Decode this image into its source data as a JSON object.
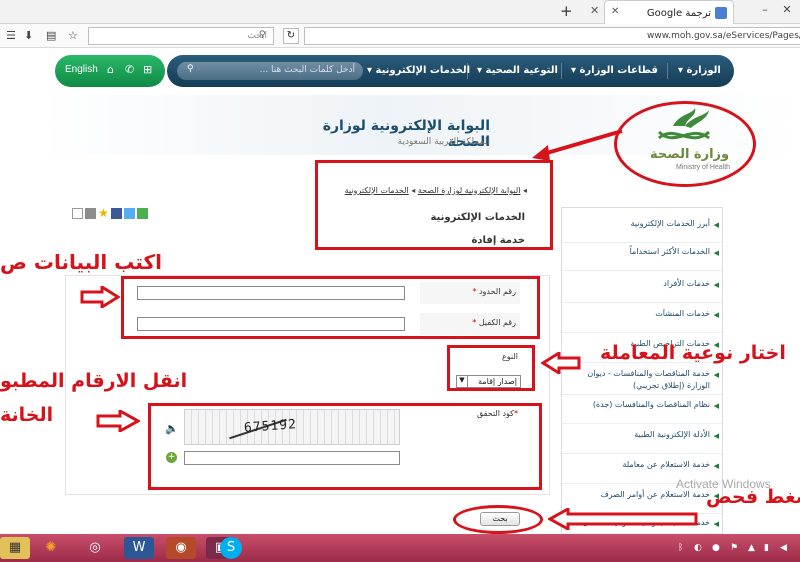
{
  "browser": {
    "tab_title": "ترجمة Google",
    "search_placeholder": "ابحث",
    "url": "www.moh.gov.sa/eServices/Pages/Efad",
    "controls": {
      "minimize": "–",
      "close": "✕",
      "new_tab": "+",
      "tab_close": "✕"
    }
  },
  "header": {
    "lang_label": "English",
    "search_placeholder": "أدخل كلمات البحث هنا ...",
    "nav": [
      "الوزارة",
      "قطاعات الوزارة",
      "التوعية الصحية",
      "الخدمات الإلكترونية"
    ],
    "portal_title": "البوابة الإلكترونية لوزارة الصحة",
    "portal_subtitle": "المملكة العربية السعودية",
    "logo_ar": "وزارة الصحة",
    "logo_en": "Ministry of Health",
    "logo_color": "#6b8a3a"
  },
  "breadcrumb": {
    "item1": "البوابة الإلكترونية لوزارة الصحة",
    "item2": "الخدمات الإلكترونية"
  },
  "page": {
    "section_title": "الخدمات الإلكترونية",
    "service_title": "خدمة إفادة"
  },
  "form": {
    "border_no_label": "رقم الحدود",
    "sponsor_no_label": "رقم الكفيل",
    "type_label": "النوع",
    "type_value": "إصدار إقامة",
    "captcha_label": "كود التحقق",
    "captcha_code": "675192",
    "submit_label": "بحث",
    "required_mark": "*"
  },
  "sidebar": {
    "items": [
      "أبرز الخدمات الإلكترونية",
      "الخدمات الأكثر استخداماً",
      "خدمات الأفراد",
      "خدمات المنشآت",
      "خدمات التراخيص الطبية",
      "خدمة المناقصات والمنافسات - ديوان الوزارة (إطلاق تجريبي)",
      "نظام المناقصات والمنافسات (جدة)",
      "الأدلة الإلكترونية الطبية",
      "خدمة الاستعلام عن معاملة",
      "خدمة الاستعلام عن أوامر الصرف",
      "خدمة المتابعة بمواعيد المواليد للأطفال"
    ]
  },
  "annotations": {
    "write_data": "اكتب البيانات ص",
    "choose_type": "اختار نوعية المعاملة",
    "copy_numbers_line1": "انقل الارقام المطبو",
    "copy_numbers_line2": "الخانة",
    "press_search": "اضغط فحص",
    "color": "#d6121b"
  },
  "watermark": "Activate Windows"
}
